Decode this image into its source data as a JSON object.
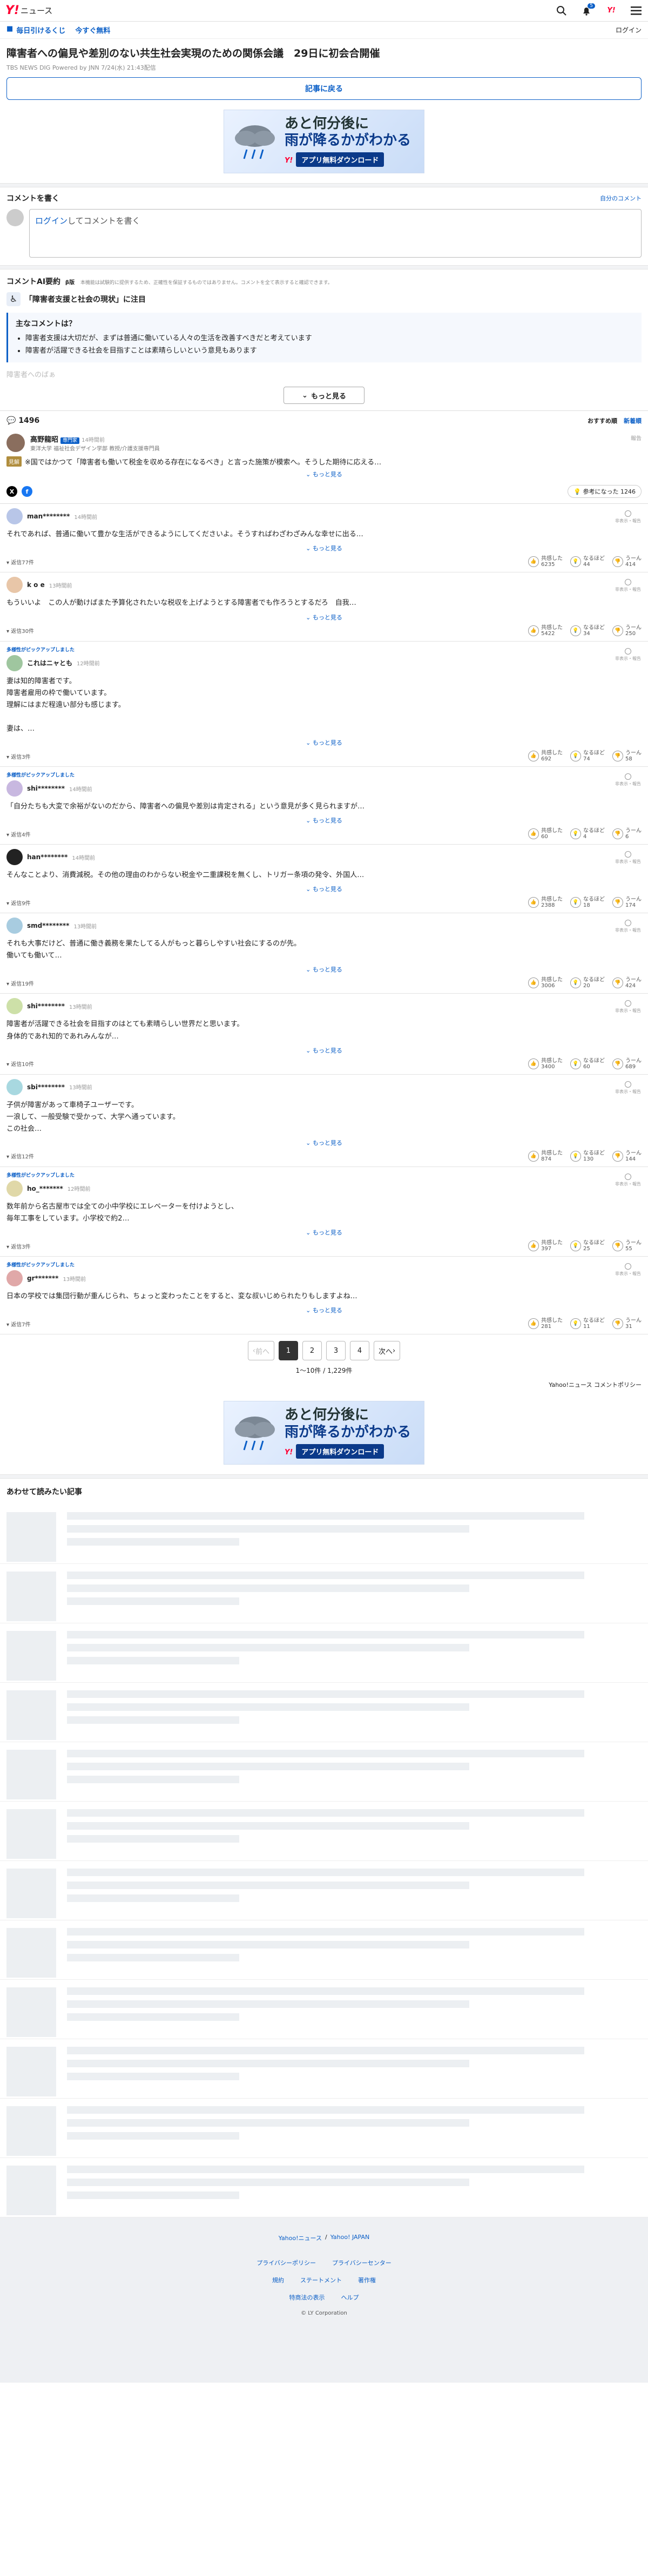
{
  "header": {
    "brand_y": "Y!",
    "brand_news": "ニュース",
    "notify_count": "5"
  },
  "subbar": {
    "link1": "毎日引けるくじ",
    "link2": "今すぐ無料",
    "login": "ログイン"
  },
  "article": {
    "title": "障害者への偏見や差別のない共生社会実現のための関係会議　29日に初会合開催",
    "meta": "TBS NEWS DIG Powered by JNN 7/24(水) 21:43配信",
    "back_button": "記事に戻る"
  },
  "ad": {
    "line1": "あと何分後に",
    "line2": "雨が降るかがわかる",
    "cta": "アプリ無料ダウンロード",
    "brand": "Y!"
  },
  "write": {
    "heading": "コメントを書く",
    "policy_link": "自分のコメント",
    "placeholder_link": "ログイン",
    "placeholder_rest": "してコメントを書く"
  },
  "ai": {
    "heading": "コメントAI要約",
    "beta": "β版",
    "note": "本機能は試験的に提供するため、正確性を保証するものではありません。コメントを全て表示すると確認できます。",
    "topic": "「障害者支援と社会の現状」に注目",
    "card_title": "主なコメントは？",
    "bullets": [
      "障害者支援は大切だが、まずは普通に働いている人々の生活を改善すべきだと考えています",
      "障害者が活躍できる社会を目指すことは素晴らしいという意見もあります"
    ],
    "faded": "障害者へのばぁ",
    "more": "もっと見る"
  },
  "comments_bar": {
    "count": "1496",
    "sort_recommended": "おすすめ順",
    "sort_new": "新着順"
  },
  "expert": {
    "name": "高野龍昭",
    "tag": "専門家",
    "time": "14時間前",
    "desc": "東洋大学 福祉社会デザイン学部 教授/介護支援専門員",
    "report": "報告",
    "label": "見解",
    "text": "※国ではかつて「障害者も働いて税金を収める存在になるべき」と言った施策が模索へ。そうした期待に応える…",
    "more": "もっと見る",
    "helped": "参考になった",
    "helped_count": "1246"
  },
  "comments": [
    {
      "pick": "",
      "user": "man********",
      "time": "14時間前",
      "body": "それであれば、普通に働いて豊かな生活ができるようにしてくださいよ。そうすればわざわざみんな幸せに出る…",
      "replies": "返信77件",
      "r1": "6235",
      "r2": "44",
      "r3": "414"
    },
    {
      "pick": "",
      "user": "k o e",
      "time": "13時間前",
      "body": "もういいよ　この人が動けばまた予算化されたいな税収を上げようとする障害者でも作ろうとするだろ　自我…",
      "replies": "返信30件",
      "r1": "5422",
      "r2": "34",
      "r3": "250"
    },
    {
      "pick": "多様性がピックアップしました",
      "user": "これはニャとも",
      "time": "12時間前",
      "body": "妻は知的障害者です。\n障害者雇用の枠で働いています。\n理解にはまだ程遠い部分も感じます。\n\n妻は、…",
      "replies": "返信3件",
      "r1": "692",
      "r2": "74",
      "r3": "58"
    },
    {
      "pick": "多様性がピックアップしました",
      "user": "shi********",
      "time": "14時間前",
      "body": "「自分たちも大変で余裕がないのだから、障害者への偏見や差別は肯定される」という意見が多く見られますが…",
      "replies": "返信4件",
      "r1": "60",
      "r2": "4",
      "r3": "6"
    },
    {
      "pick": "",
      "user": "han********",
      "time": "14時間前",
      "body": "そんなことより、消費減税。その他の理由のわからない税金や二重課税を無くし、トリガー条項の発令、外国人…",
      "replies": "返信9件",
      "r1": "2388",
      "r2": "18",
      "r3": "174"
    },
    {
      "pick": "",
      "user": "smd********",
      "time": "13時間前",
      "body": "それも大事だけど、普通に働き義務を果たしてる人がもっと暮らしやすい社会にするのが先。\n働いても働いて…",
      "replies": "返信19件",
      "r1": "3006",
      "r2": "20",
      "r3": "424"
    },
    {
      "pick": "",
      "user": "shi********",
      "time": "13時間前",
      "body": "障害者が活躍できる社会を目指すのはとても素晴らしい世界だと思います。\n身体的であれ知的であれみんなが…",
      "replies": "返信10件",
      "r1": "3400",
      "r2": "60",
      "r3": "689"
    },
    {
      "pick": "",
      "user": "sbi********",
      "time": "13時間前",
      "body": "子供が障害があって車椅子ユーザーです。\n一浪して、一般受験で受かって、大学へ通っています。\nこの社会…",
      "replies": "返信12件",
      "r1": "874",
      "r2": "130",
      "r3": "144"
    },
    {
      "pick": "多様性がピックアップしました",
      "user": "ho_*******",
      "time": "12時間前",
      "body": "数年前から名古屋市では全ての小中学校にエレベーターを付けようとし、\n毎年工事をしています。小学校で約2…",
      "replies": "返信3件",
      "r1": "397",
      "r2": "25",
      "r3": "55"
    },
    {
      "pick": "多様性がピックアップしました",
      "user": "gr*******",
      "time": "13時間前",
      "body": "日本の学校では集団行動が重んじられ、ちょっと変わったことをすると、変な叔いじめられたりもしますよね…",
      "replies": "返信7件",
      "r1": "281",
      "r2": "11",
      "r3": "31"
    }
  ],
  "react_labels": {
    "a": "共感した",
    "b": "なるほど",
    "c": "うーん"
  },
  "misc": {
    "report": "非表示・報告",
    "more": "もっと見る"
  },
  "pager": {
    "prev": "前へ",
    "pages": [
      "1",
      "2",
      "3",
      "4"
    ],
    "next": "次へ",
    "count": "1〜10件 / 1,229件",
    "policy": "Yahoo!ニュース コメントポリシー"
  },
  "recommend": {
    "title": "あわせて読みたい記事"
  },
  "footer": {
    "top1": "Yahoo!ニュース",
    "top2": "Yahoo! JAPAN",
    "r1": [
      "プライバシーポリシー",
      "プライバシーセンター"
    ],
    "r2": [
      "規約",
      "ステートメント",
      "著作権"
    ],
    "r3": [
      "特商法の表示",
      "ヘルプ"
    ],
    "copy": "© LY Corporation"
  },
  "colors": {
    "accent": "#0b5fc7",
    "brand": "#ff0033"
  }
}
